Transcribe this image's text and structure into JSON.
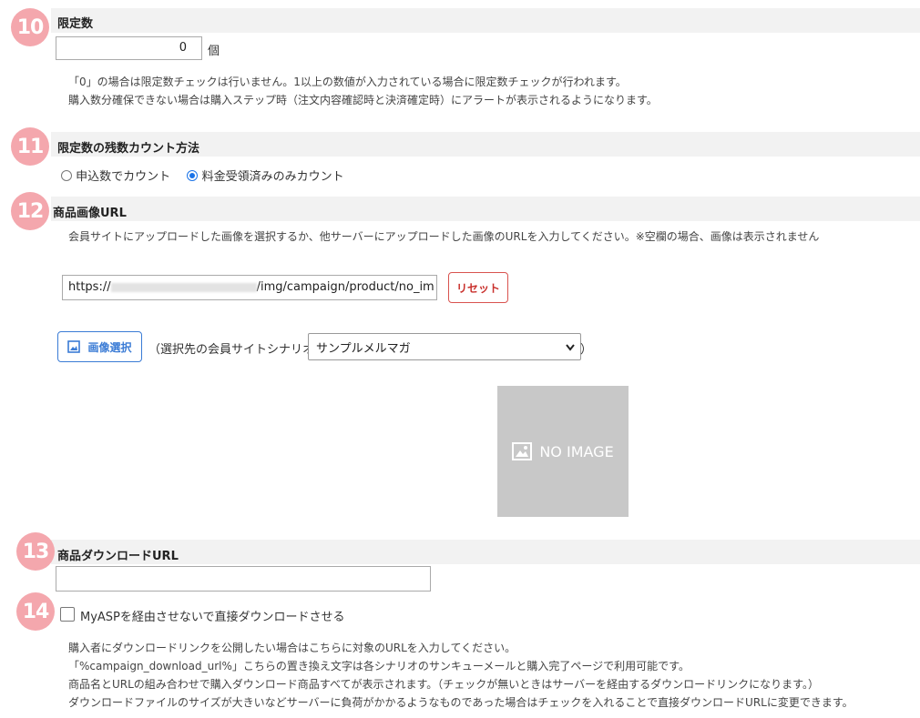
{
  "sections": {
    "s10": {
      "number": "10",
      "title": "限定数",
      "input_value": "0",
      "unit": "個",
      "notes": [
        "「0」の場合は限定数チェックは行いません。1以上の数値が入力されている場合に限定数チェックが行われます。",
        "購入数分確保できない場合は購入ステップ時（注文内容確認時と決済確定時）にアラートが表示されるようになります。"
      ]
    },
    "s11": {
      "number": "11",
      "title": "限定数の残数カウント方法",
      "option_1": "申込数でカウント",
      "option_2": "料金受領済みのみカウント",
      "selected": "option_2"
    },
    "s12": {
      "number": "12",
      "title": "商品画像URL",
      "note": "会員サイトにアップロードした画像を選択するか、他サーバーにアップロードした画像のURLを入力してください。※空欄の場合、画像は表示されません",
      "url_prefix": "https://",
      "url_suffix": "/img/campaign/product/no_im",
      "reset_label": "リセット",
      "image_select_label": "画像選択",
      "scenario_label_open": "（選択先の会員サイトシナリオ",
      "scenario_value": "サンプルメルマガ",
      "scenario_label_close": "）",
      "no_image_text": "NO IMAGE"
    },
    "s13": {
      "number": "13",
      "title": "商品ダウンロードURL",
      "input_value": ""
    },
    "s14": {
      "number": "14",
      "checkbox_label": "MyASPを経由させないで直接ダウンロードさせる",
      "checked": false,
      "notes": [
        "購入者にダウンロードリンクを公開したい場合はこちらに対象のURLを入力してください。",
        "「%campaign_download_url%」こちらの置き換え文字は各シナリオのサンキューメールと購入完了ページで利用可能です。",
        "商品名とURLの組み合わせで購入ダウンロード商品すべてが表示されます。（チェックが無いときはサーバーを経由するダウンロードリンクになります。）",
        "ダウンロードファイルのサイズが大きいなどサーバーに負荷がかかるようなものであった場合はチェックを入れることで直接ダウンロードURLに変更できます。"
      ]
    }
  },
  "colors": {
    "badge": "#f4a7ad",
    "section_bar": "#f2f2f2",
    "reset_button": "#d9534f",
    "image_button": "#3a7bd5",
    "radio_selected": "#1a73e8"
  },
  "icons": [
    "image-icon",
    "chevron-down-icon"
  ]
}
